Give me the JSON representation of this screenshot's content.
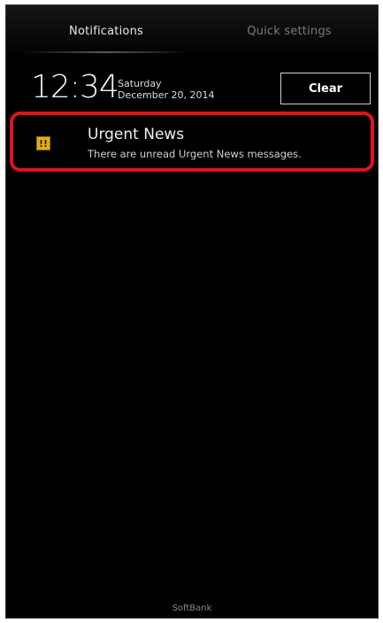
{
  "tabs": {
    "notifications": "Notifications",
    "quick_settings": "Quick settings"
  },
  "header": {
    "time": "12:34",
    "day": "Saturday",
    "date": "December 20, 2014",
    "clear_label": "Clear"
  },
  "notification": {
    "icon": "warning-icon",
    "icon_glyph": "!!",
    "title": "Urgent News",
    "text": "There are unread Urgent News messages."
  },
  "footer": {
    "carrier": "SoftBank"
  },
  "colors": {
    "highlight": "#e0121e",
    "icon_bg": "#e2ad18",
    "background": "#000000"
  }
}
